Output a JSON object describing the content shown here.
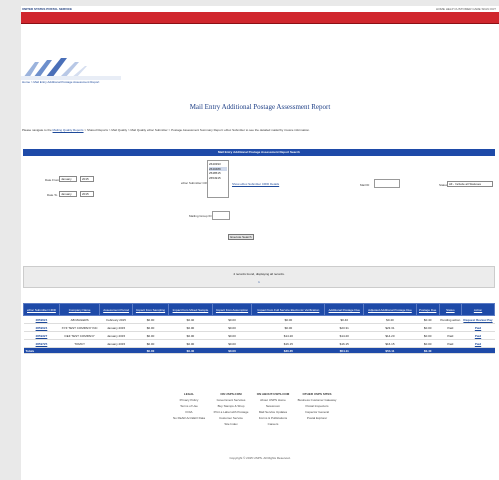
{
  "header": {
    "logo": "UNITED STATES POSTAL SERVICE",
    "links": "HOME  HELP  CUSTOMER CARE  SIGN OUT"
  },
  "breadcrumb": "Home > Mail Entry Additional Postage Assessment Report",
  "page_title": "Mail Entry Additional Postage Assessment Report",
  "nav": {
    "prefix": "Please navigate to the ",
    "link": "Mailing Quality Reports",
    "suffix": " > Shared Reports > Mail Quality > Mail Quality eDoc Submitter > Postage Assessment Summary Report: eDoc Submitter to see the detailed mailer/by invoice information."
  },
  "search": {
    "header": "Mail Entry Additional Postage Assessment Report Search",
    "date_from_label": "Date From",
    "date_from_month": "January",
    "date_from_year": "2015",
    "date_to_label": "Date To",
    "date_to_month": "January",
    "date_to_year": "2015",
    "edoc_label": "eDoc Submitter CRID",
    "edoc_options": [
      "2640393",
      "2640489",
      "2548515",
      "2654915"
    ],
    "edoc_link": "Show eDoc Submitter CRID Details",
    "mailing_group_label": "Mailing Group ID",
    "mail_id_label": "Mail ID",
    "status_label": "Status",
    "status_value": "All - Include all Statuses",
    "button": "Execute Search"
  },
  "results": {
    "count_text": "4 records found, displaying all records.",
    "pager": "1",
    "columns": [
      "eDoc Submitter CRID",
      "Company Name",
      "Assessment Period",
      "Impact from Sampling",
      "Impact from Mixed Sample",
      "Impact from Assumption",
      "Impact from Full Service Electronic Verification",
      "Additional Postage Due",
      "Adjusted Additional Postage Due",
      "Postage Due",
      "Status",
      "Action"
    ],
    "rows": [
      [
        "2859624",
        "AB MAILERS",
        "February 2015",
        "$0.00",
        "$0.40",
        "$0.00",
        "$0.00",
        "$0.40",
        "$0.40",
        "$0.40",
        "Pending action",
        "Request Review Pay"
      ],
      [
        "2859024",
        "XYZ TEST COMPANY INC",
        "January 2015",
        "$0.00",
        "$0.00",
        "$0.00",
        "$0.00",
        "$23.31",
        "$23.31",
        "$0.00",
        "Paid",
        "Paid"
      ],
      [
        "2859327",
        "DEF TEST COMPANY",
        "January 2015",
        "$0.00",
        "$0.00",
        "$0.00",
        "$14.20",
        "$14.20",
        "$14.20",
        "$0.00",
        "Paid",
        "Paid"
      ],
      [
        "2859725",
        "TOMCY",
        "January 2015",
        "$0.00",
        "$0.00",
        "$0.00",
        "$16.15",
        "$16.15",
        "$16.15",
        "$0.00",
        "Paid",
        "Paid"
      ]
    ],
    "totals": [
      "Totals",
      "",
      "",
      "$0.00",
      "$0.40",
      "$0.00",
      "$30.35",
      "$54.11",
      "$54.11",
      "$0.40",
      "",
      ""
    ]
  },
  "footer": {
    "columns": [
      {
        "title": "LEGAL",
        "items": [
          "Privacy Policy",
          "Terms of Use",
          "FOIA",
          "No FEAR Act EEO Data"
        ]
      },
      {
        "title": "ON USPS.COM",
        "items": [
          "Government Services",
          "Buy Stamps & Shop",
          "Print a Label with Postage",
          "Customer Service",
          "Site Index"
        ]
      },
      {
        "title": "ON ABOUT.USPS.COM",
        "items": [
          "About USPS Home",
          "Newsroom",
          "Mail Service Updates",
          "Forms & Publications",
          "Careers"
        ]
      },
      {
        "title": "OTHER USPS SITES",
        "items": [
          "Business Customer Gateway",
          "Postal Inspectors",
          "Inspector General",
          "Postal Explorer"
        ]
      }
    ],
    "copyright": "Copyright © 2015 USPS. All Rights Reserved."
  }
}
